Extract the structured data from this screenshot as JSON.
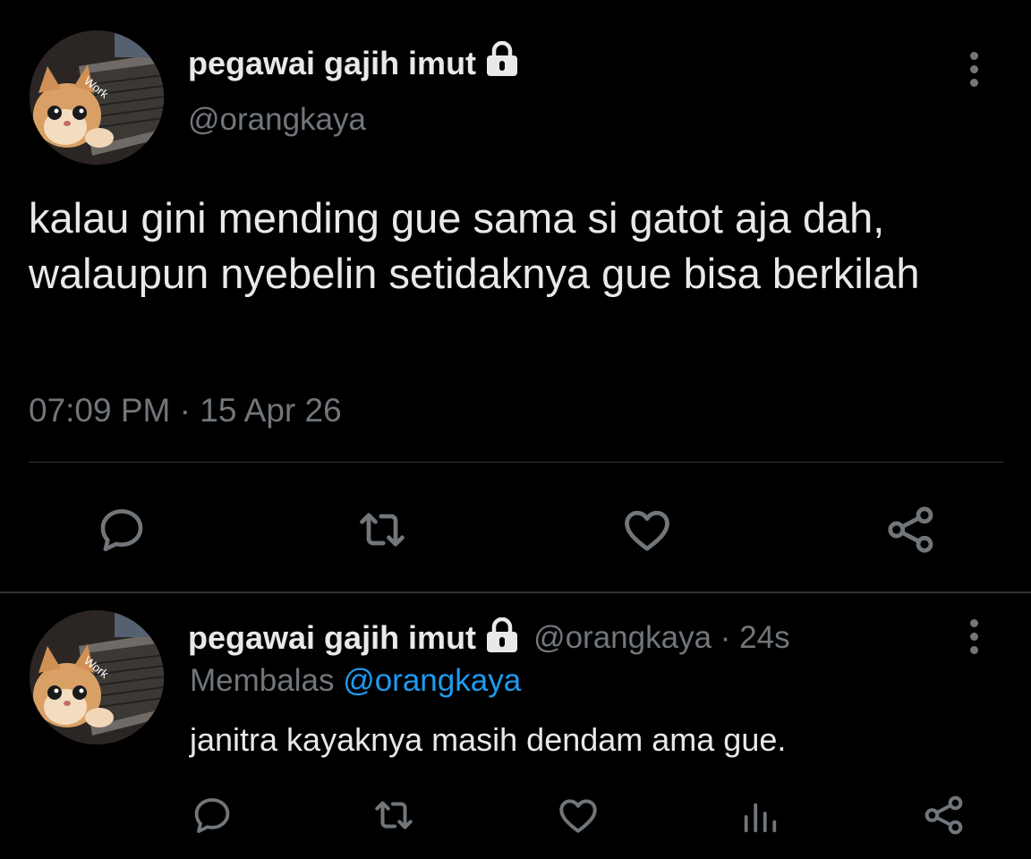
{
  "tweet": {
    "display_name": "pegawai gajih imut",
    "handle": "@orangkaya",
    "text": "kalau gini mending gue sama si gatot aja dah, walaupun nyebelin setidaknya gue bisa berkilah",
    "timestamp": "07:09 PM · 15 Apr 26",
    "avatar_badge_text": "Work",
    "actions": [
      "reply-icon",
      "retweet-icon",
      "like-icon",
      "share-icon"
    ]
  },
  "reply": {
    "display_name": "pegawai gajih imut",
    "meta": "@orangkaya · 24s",
    "replying_prefix": "Membalas",
    "replying_to": "@orangkaya",
    "text": "janitra kayaknya masih dendam ama gue.",
    "avatar_badge_text": "Work",
    "actions": [
      "reply-icon",
      "retweet-icon",
      "like-icon",
      "analytics-icon",
      "share-icon"
    ]
  },
  "colors": {
    "background": "#000000",
    "text_primary": "#e7e9ea",
    "text_secondary": "#71767b",
    "accent": "#1d9bf0",
    "divider": "#2f3336"
  }
}
